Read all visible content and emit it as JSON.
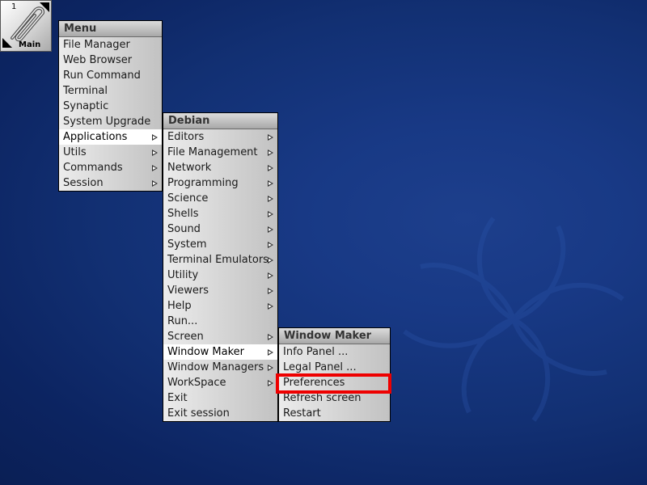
{
  "dock": {
    "workspace_number": "1",
    "label": "Main"
  },
  "main_menu": {
    "title": "Menu",
    "items": [
      {
        "label": "File Manager",
        "submenu": false
      },
      {
        "label": "Web Browser",
        "submenu": false
      },
      {
        "label": "Run Command",
        "submenu": false
      },
      {
        "label": "Terminal",
        "submenu": false
      },
      {
        "label": "Synaptic",
        "submenu": false
      },
      {
        "label": "System Upgrade",
        "submenu": false
      },
      {
        "label": "Applications",
        "submenu": true,
        "selected": true
      },
      {
        "label": "Utils",
        "submenu": true
      },
      {
        "label": "Commands",
        "submenu": true
      },
      {
        "label": "Session",
        "submenu": true
      }
    ]
  },
  "debian_menu": {
    "title": "Debian",
    "items": [
      {
        "label": "Editors",
        "submenu": true
      },
      {
        "label": "File Management",
        "submenu": true
      },
      {
        "label": "Network",
        "submenu": true
      },
      {
        "label": "Programming",
        "submenu": true
      },
      {
        "label": "Science",
        "submenu": true
      },
      {
        "label": "Shells",
        "submenu": true
      },
      {
        "label": "Sound",
        "submenu": true
      },
      {
        "label": "System",
        "submenu": true
      },
      {
        "label": "Terminal Emulators",
        "submenu": true
      },
      {
        "label": "Utility",
        "submenu": true
      },
      {
        "label": "Viewers",
        "submenu": true
      },
      {
        "label": "Help",
        "submenu": true
      },
      {
        "label": "Run...",
        "submenu": false
      },
      {
        "label": "Screen",
        "submenu": true
      },
      {
        "label": "Window Maker",
        "submenu": true,
        "selected": true
      },
      {
        "label": "Window Managers",
        "submenu": true
      },
      {
        "label": "WorkSpace",
        "submenu": true
      },
      {
        "label": "Exit",
        "submenu": false
      },
      {
        "label": "Exit session",
        "submenu": false
      }
    ]
  },
  "wmaker_menu": {
    "title": "Window Maker",
    "items": [
      {
        "label": "Info Panel ...",
        "submenu": false
      },
      {
        "label": "Legal Panel ...",
        "submenu": false
      },
      {
        "label": "Preferences",
        "submenu": false,
        "highlighted": true
      },
      {
        "label": "Refresh screen",
        "submenu": false
      },
      {
        "label": "Restart",
        "submenu": false
      }
    ]
  },
  "colors": {
    "desktop": "#123073",
    "highlight": "#ee0000",
    "selected_item": "#ffffff"
  }
}
